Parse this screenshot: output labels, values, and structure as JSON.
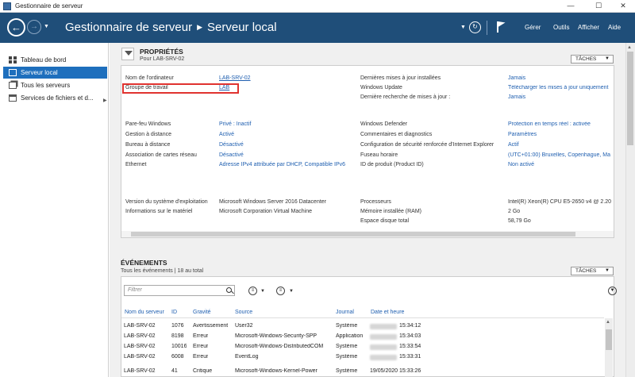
{
  "window": {
    "title": "Gestionnaire de serveur",
    "controls": {
      "minimize": "—",
      "maximize": "☐",
      "close": "✕"
    }
  },
  "header": {
    "breadcrumb_root": "Gestionnaire de serveur",
    "breadcrumb_current": "Serveur local",
    "menu": [
      "Gérer",
      "Outils",
      "Afficher",
      "Aide"
    ]
  },
  "sidebar": {
    "items": [
      {
        "label": "Tableau de bord",
        "icon": "dashboard-icon",
        "active": false
      },
      {
        "label": "Serveur local",
        "icon": "server-icon",
        "active": true
      },
      {
        "label": "Tous les serveurs",
        "icon": "servers-icon",
        "active": false
      },
      {
        "label": "Services de fichiers et d...",
        "icon": "files-icon",
        "active": false,
        "has_submenu": true
      }
    ]
  },
  "properties": {
    "title": "PROPRIÉTÉS",
    "subtitle": "Pour LAB-SRV-02",
    "tasks_label": "TÂCHES",
    "rows": [
      {
        "label": "Nom de l'ordinateur",
        "value": "LAB-SRV-02"
      },
      {
        "label": "Groupe de travail",
        "value": "LAB"
      },
      {
        "label": "Dernières mises à jour installées",
        "value": "Jamais"
      },
      {
        "label": "Windows Update",
        "value": "Télécharger les mises à jour uniquement"
      },
      {
        "label": "Dernière recherche de mises à jour :",
        "value": "Jamais"
      },
      {
        "label": "Pare-feu Windows",
        "value": "Privé : Inactif"
      },
      {
        "label": "Gestion à distance",
        "value": "Activé"
      },
      {
        "label": "Bureau à distance",
        "value": "Désactivé"
      },
      {
        "label": "Association de cartes réseau",
        "value": "Désactivé"
      },
      {
        "label": "Ethernet",
        "value": "Adresse IPv4 attribuée par DHCP, Compatible IPv6"
      },
      {
        "label": "Windows Defender",
        "value": "Protection en temps réel : activée"
      },
      {
        "label": "Commentaires et diagnostics",
        "value": "Paramètres"
      },
      {
        "label": "Configuration de sécurité renforcée d'Internet Explorer",
        "value": "Actif"
      },
      {
        "label": "Fuseau horaire",
        "value": "(UTC+01:00) Bruxelles, Copenhague, Ma"
      },
      {
        "label": "ID de produit (Product ID)",
        "value": "Non activé"
      },
      {
        "label": "Version du système d'exploitation",
        "value": "Microsoft Windows Server 2016 Datacenter"
      },
      {
        "label": "Informations sur le matériel",
        "value": "Microsoft Corporation Virtual Machine"
      },
      {
        "label": "Processeurs",
        "value": "Intel(R) Xeon(R) CPU E5-2650 v4 @ 2.20"
      },
      {
        "label": "Mémoire installée (RAM)",
        "value": "2 Go"
      },
      {
        "label": "Espace disque total",
        "value": "58,79 Go"
      }
    ]
  },
  "events": {
    "title": "ÉVÉNEMENTS",
    "subtitle": "Tous les événements | 18 au total",
    "tasks_label": "TÂCHES",
    "filter_placeholder": "Filtrer",
    "columns": [
      "Nom du serveur",
      "ID",
      "Gravité",
      "Source",
      "Journal",
      "Date et heure"
    ],
    "rows": [
      {
        "server": "LAB-SRV-02",
        "id": "1076",
        "severity": "Avertissement",
        "source": "User32",
        "log": "Système",
        "time": "15:34:12"
      },
      {
        "server": "LAB-SRV-02",
        "id": "8198",
        "severity": "Erreur",
        "source": "Microsoft-Windows-Security-SPP",
        "log": "Application",
        "time": "15:34:03"
      },
      {
        "server": "LAB-SRV-02",
        "id": "10016",
        "severity": "Erreur",
        "source": "Microsoft-Windows-DistributedCOM",
        "log": "Système",
        "time": "15:33:54"
      },
      {
        "server": "LAB-SRV-02",
        "id": "6008",
        "severity": "Erreur",
        "source": "EventLog",
        "log": "Système",
        "time": "15:33:31"
      },
      {
        "server": "LAB-SRV-02",
        "id": "41",
        "severity": "Critique",
        "source": "Microsoft-Windows-Kernel-Power",
        "log": "Système",
        "time": "19/05/2020 15:33:26"
      }
    ]
  }
}
